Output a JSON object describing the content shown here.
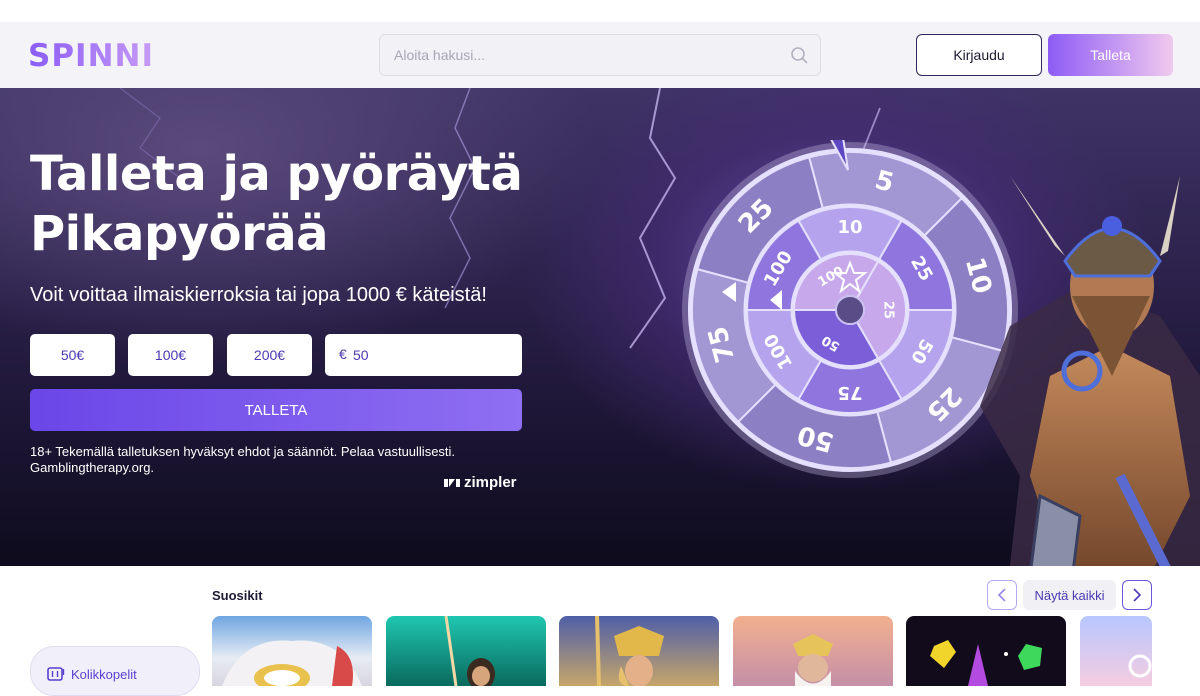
{
  "header": {
    "logo": "SPINNI",
    "search_placeholder": "Aloita hakusi...",
    "login_label": "Kirjaudu",
    "deposit_label": "Talleta"
  },
  "hero": {
    "title_line1": "Talleta ja pyöräytä",
    "title_line2": "Pikapyörää",
    "subtitle": "Voit voittaa ilmaiskierroksia tai jopa 1000 € käteistä!",
    "amounts": [
      "50€",
      "100€",
      "200€"
    ],
    "currency_symbol": "€",
    "amount_value": "50",
    "deposit_button": "TALLETA",
    "disclaimer": "18+ Tekemällä talletuksen hyväksyt ehdot ja säännöt. Pelaa vastuullisesti. Gamblingtherapy.org.",
    "payment_brand": "zimpler",
    "wheel_outer": [
      "5",
      "10",
      "25",
      "50",
      "75",
      "25"
    ],
    "wheel_middle": [
      "10",
      "25",
      "50",
      "75",
      "100",
      "100"
    ],
    "wheel_inner": [
      "25",
      "50",
      "100"
    ]
  },
  "favorites": {
    "title": "Suosikit",
    "show_all": "Näytä kaikki"
  },
  "sidebar": {
    "slots_label": "Kolikkopelit"
  },
  "icons": {
    "search": "search-icon",
    "prev": "chevron-left-icon",
    "next": "chevron-right-icon",
    "slots": "slot-machine-icon",
    "star": "star-icon"
  },
  "colors": {
    "brand": "#8a5cf6",
    "accent_dark": "#4b3ab3",
    "hero_bg": "#241b40"
  }
}
